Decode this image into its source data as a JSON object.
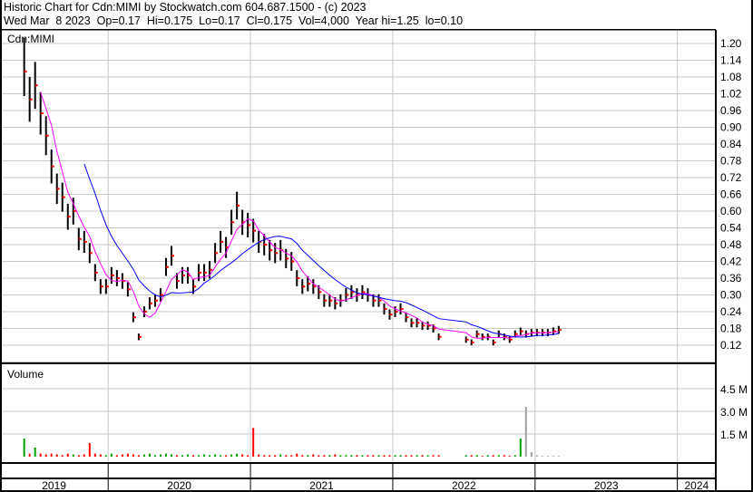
{
  "header": {
    "title": "Historic Chart for Cdn:MIMI by Stockwatch.com 604.687.1500 - (c) 2023",
    "quote": "Wed Mar  8 2023  Op=0.17  Hi=0.175  Lo=0.17  Cl=0.175  Vol=4,000  Year hi=1.25  lo=0.10"
  },
  "chart_data": {
    "type": "bar",
    "symbol_label": "Cdn:MIMI",
    "volume_label": "Volume",
    "colors": {
      "bar": "#000000",
      "close": "#ff0000",
      "ma_short": "#ff00ff",
      "ma_long": "#0000ff",
      "vol_up": "#00a000",
      "vol_down": "#ff0000",
      "vol_flat": "#a0a0a0",
      "grid": "#c8c8c8"
    },
    "price_ticks": [
      "1.20",
      "1.14",
      "1.08",
      "1.02",
      "0.96",
      "0.90",
      "0.84",
      "0.78",
      "0.72",
      "0.66",
      "0.60",
      "0.54",
      "0.48",
      "0.42",
      "0.36",
      "0.30",
      "0.24",
      "0.18",
      "0.12"
    ],
    "price_range": [
      0.06,
      1.23
    ],
    "volume_ticks": [
      {
        "v": 4.5,
        "label": "4.5 M"
      },
      {
        "v": 3.0,
        "label": "3.0 M"
      },
      {
        "v": 1.5,
        "label": "1.5 M"
      }
    ],
    "volume_range_millions": [
      0,
      5.7
    ],
    "years": [
      {
        "label": "2019",
        "start": 2019.0
      },
      {
        "label": "2020",
        "start": 2020.0
      },
      {
        "label": "2021",
        "start": 2021.0
      },
      {
        "label": "2022",
        "start": 2022.0
      },
      {
        "label": "2023",
        "start": 2023.0
      },
      {
        "label": "2024",
        "start": 2024.0
      }
    ],
    "x_range_years": [
      2019.24,
      2024.27
    ],
    "series_start_year": 2019.41,
    "interval_weeks": 2,
    "typical_range_pct": 8,
    "ma_periods": [
      4,
      12
    ],
    "closes": [
      1.1,
      1.0,
      1.05,
      0.95,
      0.87,
      0.76,
      0.68,
      0.65,
      0.58,
      0.6,
      0.5,
      0.49,
      0.45,
      0.38,
      0.33,
      0.33,
      0.37,
      0.36,
      0.35,
      0.32,
      0.22,
      0.15,
      0.24,
      0.27,
      0.28,
      0.3,
      0.4,
      0.44,
      0.35,
      0.37,
      0.37,
      0.33,
      0.38,
      0.38,
      0.39,
      0.45,
      0.49,
      0.47,
      0.56,
      0.62,
      0.56,
      0.55,
      0.53,
      0.49,
      0.48,
      0.46,
      0.45,
      0.46,
      0.43,
      0.42,
      0.36,
      0.33,
      0.34,
      0.33,
      0.31,
      0.28,
      0.28,
      0.27,
      0.28,
      0.3,
      0.31,
      0.3,
      0.31,
      0.3,
      0.28,
      0.28,
      0.25,
      0.23,
      0.24,
      0.25,
      0.22,
      0.2,
      0.2,
      0.19,
      0.19,
      0.18,
      0.15,
      null,
      null,
      null,
      null,
      0.14,
      0.13,
      0.16,
      0.15,
      0.15,
      0.13,
      0.16,
      0.15,
      0.14,
      0.16,
      0.17,
      0.16,
      0.165,
      0.165,
      0.165,
      0.165,
      0.17,
      0.175
    ],
    "volume_millions": [
      1.2,
      0.2,
      0.6,
      0.2,
      0.15,
      0.2,
      0.15,
      0.1,
      0.2,
      0.15,
      0.1,
      0.15,
      0.9,
      0.2,
      0.15,
      0.1,
      0.2,
      0.1,
      0.15,
      0.2,
      0.15,
      0.1,
      0.15,
      0.2,
      0.1,
      0.15,
      0.2,
      0.15,
      0.1,
      0.1,
      0.15,
      0.1,
      0.1,
      0.15,
      0.1,
      0.15,
      0.1,
      0.1,
      0.15,
      0.2,
      0.15,
      0.1,
      1.9,
      0.15,
      0.1,
      0.1,
      0.1,
      0.15,
      0.1,
      0.1,
      0.2,
      0.1,
      0.1,
      0.15,
      0.1,
      0.1,
      0.1,
      0.15,
      0.1,
      0.1,
      0.1,
      0.1,
      0.1,
      0.1,
      0.1,
      0.1,
      0.1,
      0.1,
      0.1,
      0.1,
      0.1,
      0.1,
      0.1,
      0.1,
      0.1,
      0.1,
      0.1,
      0,
      0,
      0,
      0,
      0.1,
      0.1,
      0.1,
      0.05,
      0.1,
      0.1,
      0.1,
      0.1,
      0.05,
      0.1,
      1.2,
      3.3,
      0.3,
      0.1,
      0.05,
      0.05,
      0.05,
      0.05
    ]
  }
}
